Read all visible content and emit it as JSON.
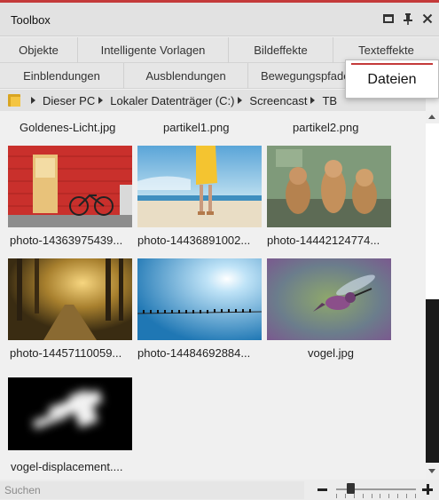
{
  "window": {
    "title": "Toolbox",
    "controls": [
      "maximize-icon",
      "pin-icon",
      "close-icon"
    ],
    "accent": "#c43a3a"
  },
  "tabs": {
    "row1": [
      "Objekte",
      "Intelligente Vorlagen",
      "Bildeffekte",
      "Texteffekte"
    ],
    "row2": [
      "Einblendungen",
      "Ausblendungen",
      "Bewegungspfade"
    ],
    "active_popup": "Dateien"
  },
  "breadcrumb": {
    "items": [
      "Dieser PC",
      "Lokaler Datenträger (C:)",
      "Screencast",
      "TB"
    ]
  },
  "files": {
    "top_partial": [
      "Goldenes-Licht.jpg",
      "partikel1.png",
      "partikel2.png"
    ],
    "items": [
      {
        "name": "photo-14363975439...",
        "thumb": "red-wall-bicycle"
      },
      {
        "name": "photo-14436891002...",
        "thumb": "beach-yellow-dress"
      },
      {
        "name": "photo-14442124774...",
        "thumb": "three-puppies"
      },
      {
        "name": "photo-14457110059...",
        "thumb": "forest-sunlight-path"
      },
      {
        "name": "photo-14484692884...",
        "thumb": "birds-on-wire-sky"
      },
      {
        "name": "vogel.jpg",
        "thumb": "hummingbird"
      },
      {
        "name": "vogel-displacement....",
        "thumb": "blurred-displacement"
      }
    ]
  },
  "search": {
    "placeholder": "Suchen",
    "value": ""
  },
  "zoom": {
    "level": 0.18
  }
}
